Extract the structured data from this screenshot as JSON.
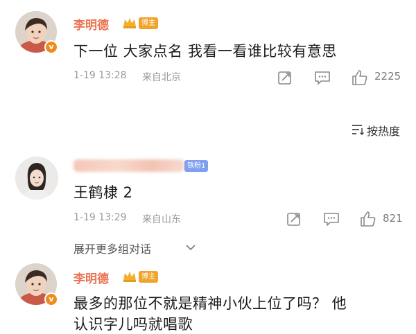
{
  "comments": [
    {
      "username": "李明德",
      "badge": "博主",
      "text": "下一位 大家点名 我看一看谁比较有意思",
      "time": "1-19 13:28",
      "location": "来自北京",
      "likes": "2225"
    },
    {
      "username": "",
      "badge": "铁粉1",
      "text": "王鹤棣 2",
      "time": "1-19 13:29",
      "location": "来自山东",
      "likes": "821"
    },
    {
      "username": "李明德",
      "badge": "博主",
      "text_line1": "最多的那位不就是精神小伙上位了吗？ 他",
      "text_line2": "认识字儿吗就唱歌"
    }
  ],
  "sort": {
    "label": "按热度"
  },
  "expand": {
    "label": "展开更多组对话"
  },
  "verified_mark": "v",
  "icons": {
    "repost": "repost-icon",
    "comment": "comment-icon",
    "like": "thumbs-up-icon",
    "sort": "sort-icon",
    "expand": "chevron-down-icon",
    "vip": "crown-icon"
  },
  "colors": {
    "username": "#eb7350",
    "badge_bozhu": "#f0a52a",
    "badge_fans": "#7f9ff0",
    "verified": "#f08a1c",
    "meta": "#9a9a9a"
  }
}
